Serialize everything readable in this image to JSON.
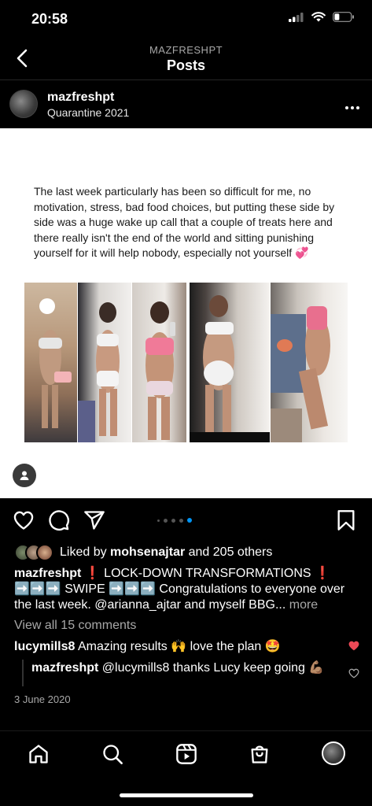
{
  "status_bar": {
    "time": "20:58"
  },
  "nav": {
    "account": "MAZFRESHPT",
    "title": "Posts"
  },
  "post_header": {
    "username": "mazfreshpt",
    "location": "Quarantine 2021"
  },
  "media": {
    "text": "The last week particularly has been so difficult for me, no motivation, stress, bad food choices, but putting these side by side was a huge wake up call that a couple of treats here and there really isn't the end of the world and sitting punishing yourself for it will help nobody, especially not yourself 💞",
    "carousel_index": 4,
    "carousel_total": 5
  },
  "likes": {
    "prefix": "Liked by ",
    "user": "mohsenajtar",
    "suffix": " and 205 others"
  },
  "caption": {
    "username": "mazfreshpt",
    "text": " ❗ LOCK-DOWN TRANSFORMATIONS ❗ ➡️➡️➡️ SWIPE ➡️➡️➡️ Congratulations to everyone over the last week. @arianna_ajtar and myself BBG... ",
    "more": "more"
  },
  "view_comments": "View all 15 comments",
  "comment": {
    "username": "lucymills8",
    "text": " Amazing results 🙌 love the plan 🤩",
    "liked": true
  },
  "reply": {
    "username": "mazfreshpt",
    "text": " @lucymills8 thanks Lucy keep going 💪🏽"
  },
  "date": "3 June 2020",
  "colors": {
    "accent_blue": "#0095f6",
    "like_red": "#ed4956",
    "muted": "#a8a8a8",
    "background": "#000000"
  },
  "icons": [
    "back-chevron-icon",
    "more-dots-icon",
    "user-tag-icon",
    "heart-icon",
    "comment-icon",
    "share-icon",
    "save-icon",
    "home-icon",
    "search-icon",
    "reels-icon",
    "shop-icon",
    "profile-avatar-icon"
  ]
}
